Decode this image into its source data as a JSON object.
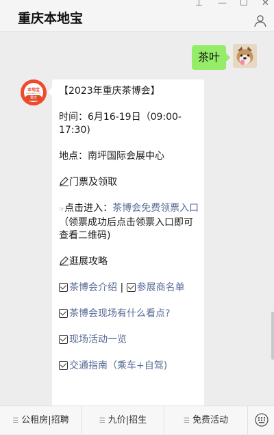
{
  "window": {
    "title": "重庆本地宝",
    "controls": {
      "pin": "⊥",
      "minimize": "—",
      "maximize": "☐",
      "close": "✕"
    }
  },
  "chat": {
    "user_message": "茶叶",
    "bot_avatar": {
      "name": "本地宝",
      "domain": "bendibao.com",
      "city": "重庆"
    },
    "bot_message": {
      "heading": "【2023年重庆茶博会】",
      "time": "时间：6月16-19日（09:00-17:30)",
      "place": "地点：南坪国际会展中心",
      "ticket_title": "门票及领取",
      "click_prefix": "点击进入：",
      "click_link": "茶博会免费领票入口",
      "click_note": "（领票成功后点击领票入口即可查看二维码)",
      "guide_title": "逛展攻略",
      "links": {
        "intro": "茶博会介绍",
        "separator": " | ",
        "exhibitors": "参展商名单",
        "highlights": "茶博会现场有什么看点?",
        "activities": "现场活动一览",
        "traffic": "交通指南（乘车+自驾)"
      }
    }
  },
  "footer": {
    "menu": [
      {
        "label": "公租房|招聘"
      },
      {
        "label": "九价|招生"
      },
      {
        "label": "免费活动"
      }
    ]
  },
  "colors": {
    "link": "#576b95",
    "user_bubble": "#95ec69",
    "brand": "#f04a2e"
  }
}
